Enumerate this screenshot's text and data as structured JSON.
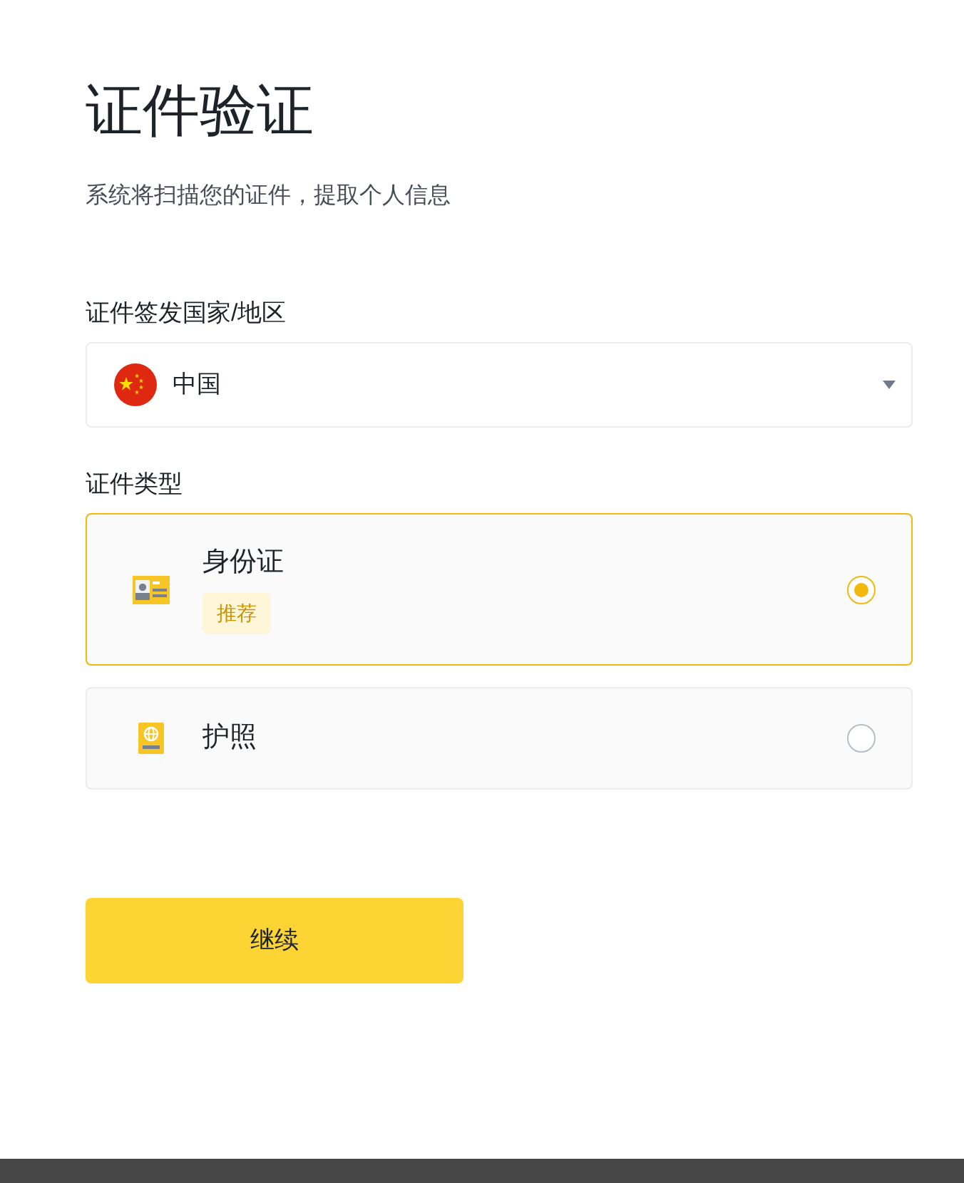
{
  "page": {
    "title": "证件验证",
    "subtitle": "系统将扫描您的证件，提取个人信息"
  },
  "country": {
    "label": "证件签发国家/地区",
    "value": "中国"
  },
  "document_type": {
    "label": "证件类型",
    "options": [
      {
        "kind": "id_card",
        "label": "身份证",
        "badge": "推荐",
        "selected": true
      },
      {
        "kind": "passport",
        "label": "护照",
        "selected": false
      }
    ]
  },
  "continue_button": {
    "label": "继续"
  }
}
